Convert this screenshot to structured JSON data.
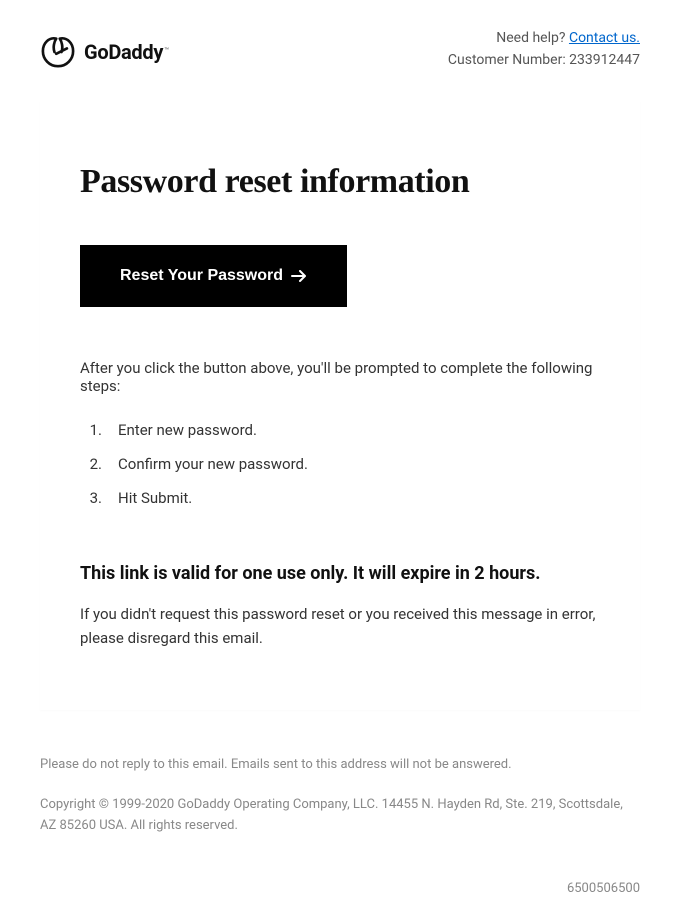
{
  "header": {
    "brand": "GoDaddy",
    "help_prefix": "Need help? ",
    "contact_label": "Contact us.",
    "customer_label": "Customer Number: 233912447"
  },
  "main": {
    "title": "Password reset information",
    "button_label": "Reset Your Password",
    "intro": "After you click the button above, you'll be prompted to complete the following steps:",
    "steps": [
      "Enter new password.",
      "Confirm your new password.",
      "Hit Submit."
    ],
    "validity_heading": "This link is valid for one use only. It will expire in 2 hours.",
    "disclaimer": "If you didn't request this password reset or you received this message in error, please disregard this email."
  },
  "footer": {
    "no_reply": "Please do not reply to this email. Emails sent to this address will not be answered.",
    "copyright": "Copyright © 1999-2020 GoDaddy Operating Company, LLC. 14455 N. Hayden Rd, Ste. 219, Scottsdale, AZ 85260 USA. All rights reserved.",
    "reference": "6500506500"
  }
}
